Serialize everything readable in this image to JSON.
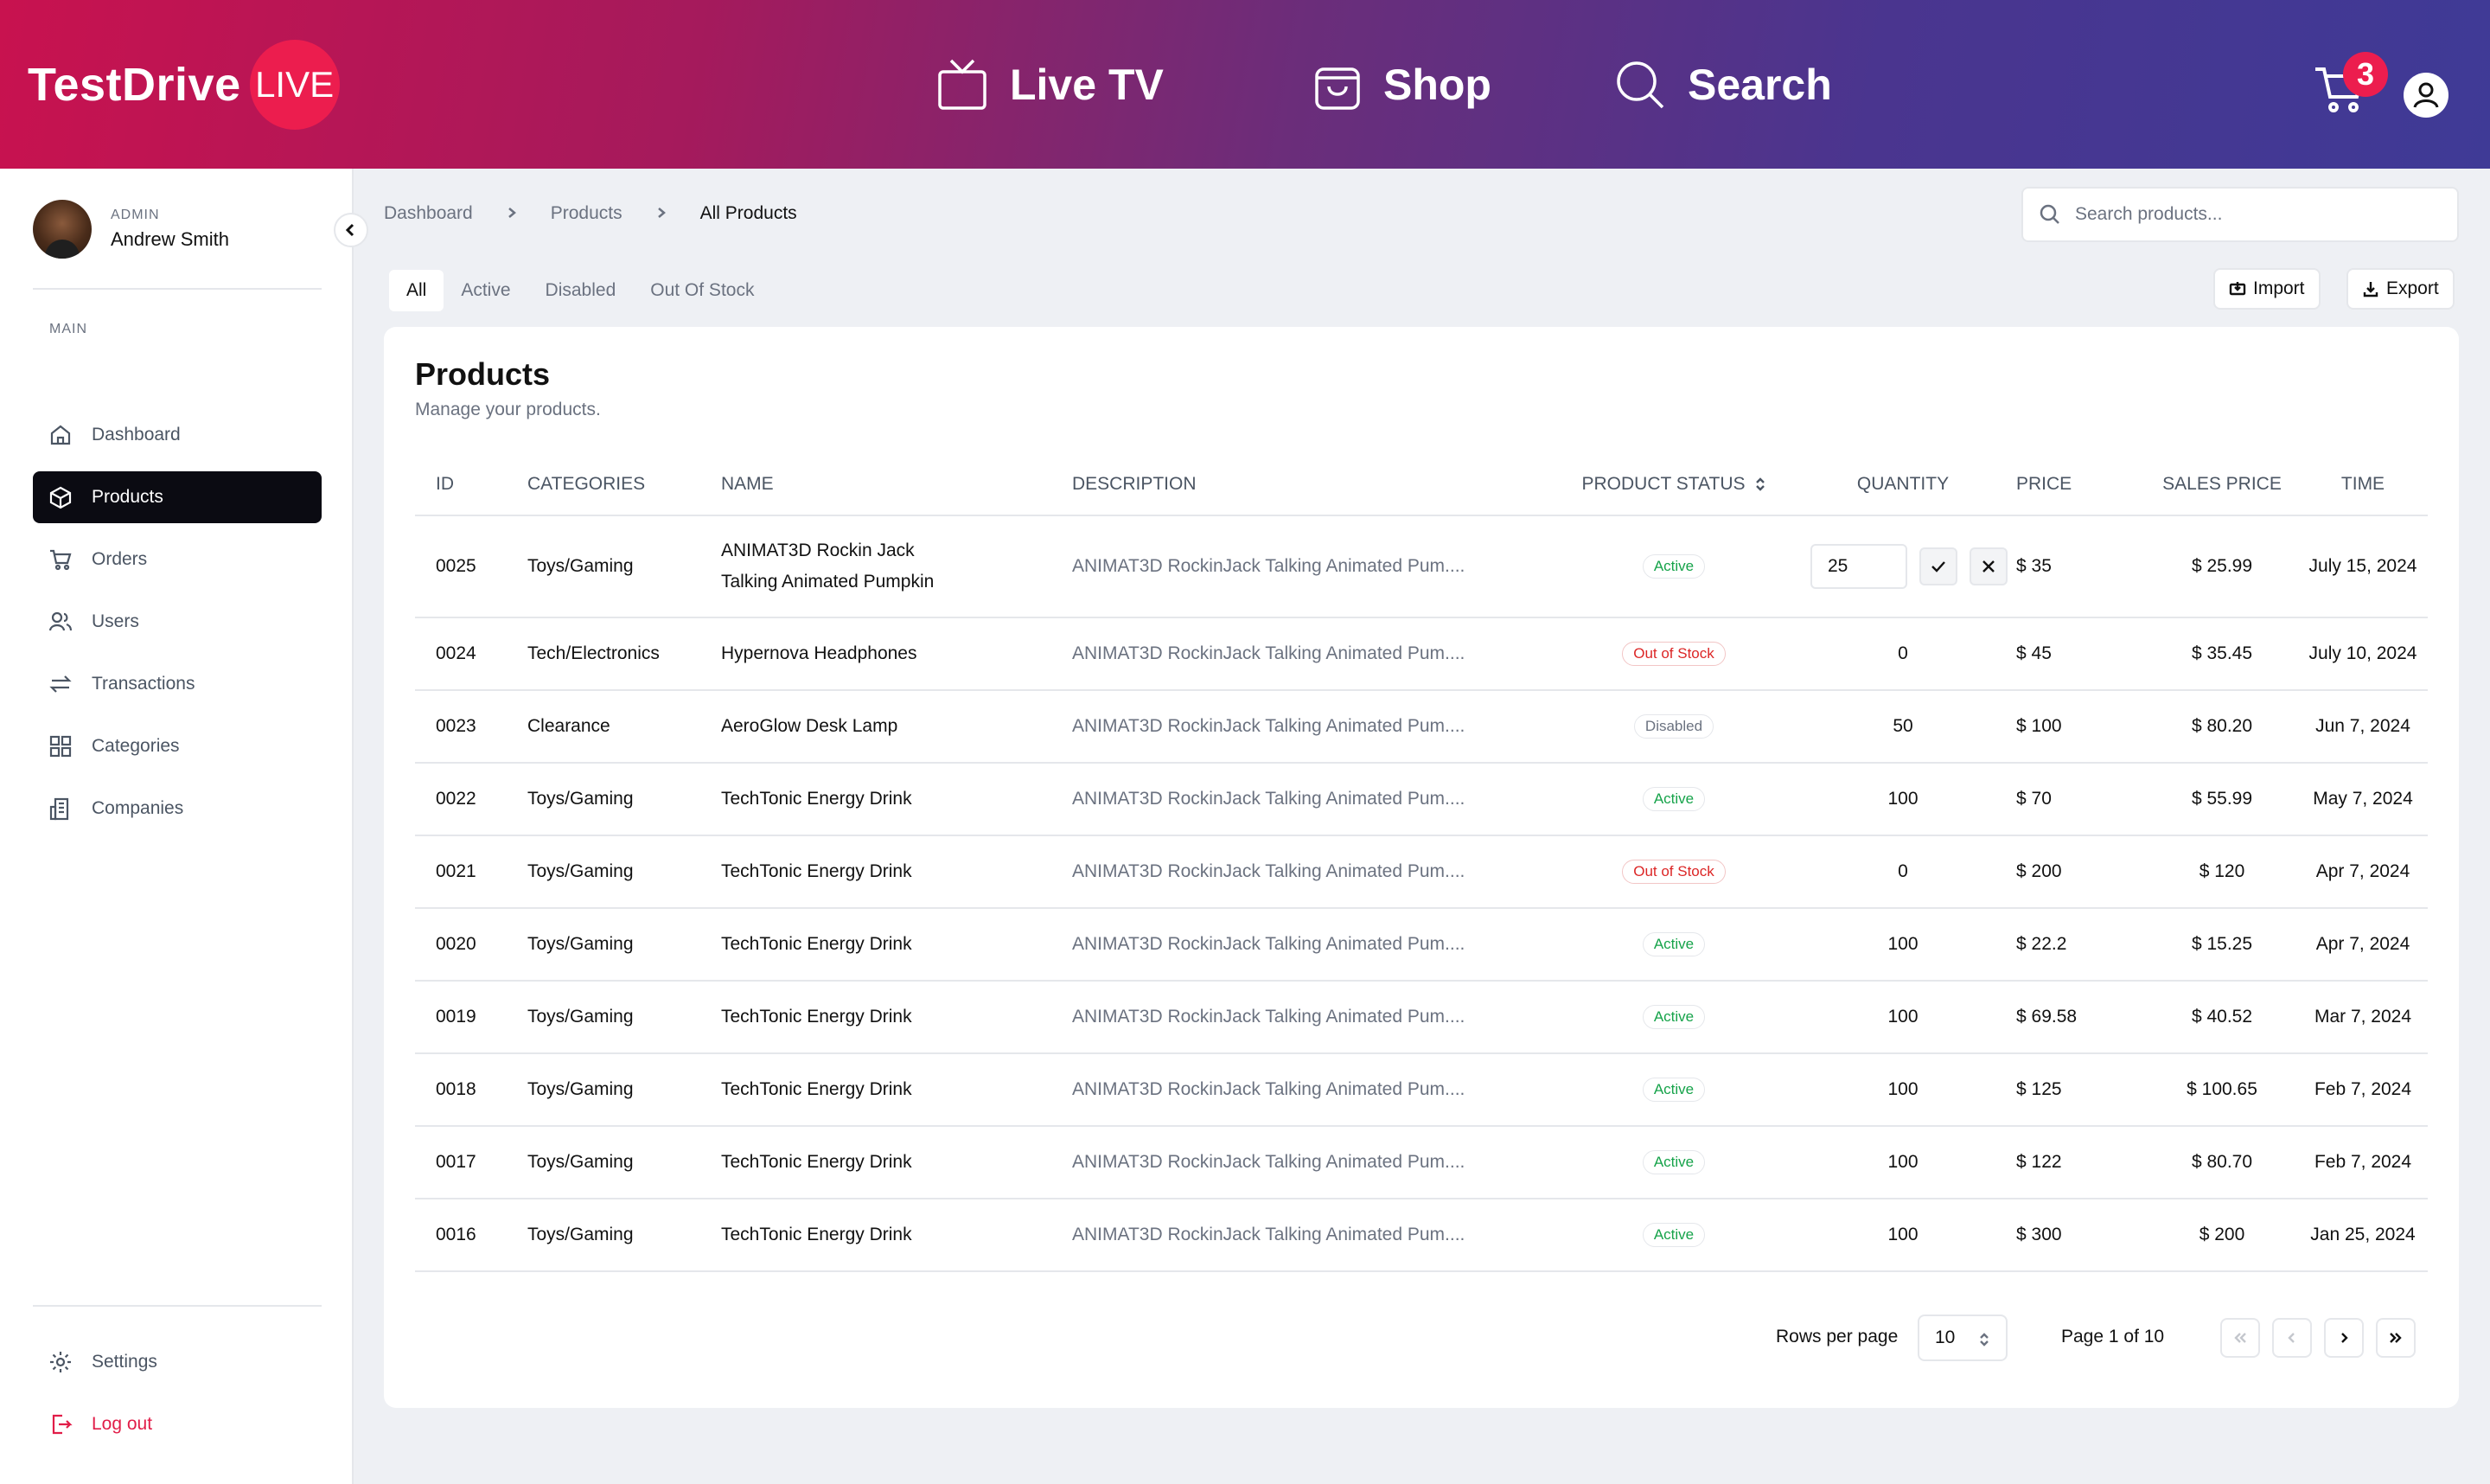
{
  "header": {
    "logo_text": "TestDrive",
    "logo_badge": "LIVE",
    "nav": [
      {
        "label": "Live TV",
        "icon": "tv-icon"
      },
      {
        "label": "Shop",
        "icon": "shopping-bag-icon"
      },
      {
        "label": "Search",
        "icon": "search-icon"
      }
    ],
    "cart_count": "3"
  },
  "sidebar": {
    "role": "ADMIN",
    "user_name": "Andrew Smith",
    "section_label": "MAIN",
    "items": [
      {
        "label": "Dashboard",
        "icon": "home-icon"
      },
      {
        "label": "Products",
        "icon": "box-icon"
      },
      {
        "label": "Orders",
        "icon": "cart-icon"
      },
      {
        "label": "Users",
        "icon": "users-icon"
      },
      {
        "label": "Transactions",
        "icon": "arrows-icon"
      },
      {
        "label": "Categories",
        "icon": "grid-icon"
      },
      {
        "label": "Companies",
        "icon": "building-icon"
      }
    ],
    "active_item": "Products",
    "bottom": {
      "settings": "Settings",
      "logout": "Log out"
    }
  },
  "breadcrumb": [
    "Dashboard",
    "Products",
    "All Products"
  ],
  "search": {
    "placeholder": "Search products..."
  },
  "tabs": [
    "All",
    "Active",
    "Disabled",
    "Out Of Stock"
  ],
  "toolbar": {
    "import": "Import",
    "export": "Export"
  },
  "card": {
    "title": "Products",
    "subtitle": "Manage your products."
  },
  "table": {
    "columns": [
      "ID",
      "CATEGORIES",
      "NAME",
      "DESCRIPTION",
      "PRODUCT STATUS",
      "QUANTITY",
      "PRICE",
      "SALES PRICE",
      "TIME"
    ],
    "rows": [
      {
        "id": "0025",
        "category": "Toys/Gaming",
        "name": "ANIMAT3D Rockin Jack Talking Animated Pumpkin",
        "desc": "ANIMAT3D RockinJack Talking Animated Pum....",
        "status": "Active",
        "qty": "25",
        "price": "$ 35",
        "sales": "$ 25.99",
        "time": "July 15, 2024"
      },
      {
        "id": "0024",
        "category": "Tech/Electronics",
        "name": "Hypernova Headphones",
        "desc": "ANIMAT3D RockinJack Talking Animated Pum....",
        "status": "Out of Stock",
        "qty": "0",
        "price": "$ 45",
        "sales": "$ 35.45",
        "time": "July 10, 2024"
      },
      {
        "id": "0023",
        "category": "Clearance",
        "name": "AeroGlow Desk Lamp",
        "desc": "ANIMAT3D RockinJack Talking Animated Pum....",
        "status": "Disabled",
        "qty": "50",
        "price": "$ 100",
        "sales": "$ 80.20",
        "time": "Jun 7, 2024"
      },
      {
        "id": "0022",
        "category": "Toys/Gaming",
        "name": "TechTonic Energy Drink",
        "desc": "ANIMAT3D RockinJack Talking Animated Pum....",
        "status": "Active",
        "qty": "100",
        "price": "$ 70",
        "sales": "$ 55.99",
        "time": "May 7, 2024"
      },
      {
        "id": "0021",
        "category": "Toys/Gaming",
        "name": "TechTonic Energy Drink",
        "desc": "ANIMAT3D RockinJack Talking Animated Pum....",
        "status": "Out of Stock",
        "qty": "0",
        "price": "$ 200",
        "sales": "$ 120",
        "time": "Apr 7, 2024"
      },
      {
        "id": "0020",
        "category": "Toys/Gaming",
        "name": "TechTonic Energy Drink",
        "desc": "ANIMAT3D RockinJack Talking Animated Pum....",
        "status": "Active",
        "qty": "100",
        "price": "$ 22.2",
        "sales": "$ 15.25",
        "time": "Apr 7, 2024"
      },
      {
        "id": "0019",
        "category": "Toys/Gaming",
        "name": "TechTonic Energy Drink",
        "desc": "ANIMAT3D RockinJack Talking Animated Pum....",
        "status": "Active",
        "qty": "100",
        "price": "$ 69.58",
        "sales": "$ 40.52",
        "time": "Mar 7, 2024"
      },
      {
        "id": "0018",
        "category": "Toys/Gaming",
        "name": "TechTonic Energy Drink",
        "desc": "ANIMAT3D RockinJack Talking Animated Pum....",
        "status": "Active",
        "qty": "100",
        "price": "$ 125",
        "sales": "$ 100.65",
        "time": "Feb 7, 2024"
      },
      {
        "id": "0017",
        "category": "Toys/Gaming",
        "name": "TechTonic Energy Drink",
        "desc": "ANIMAT3D RockinJack Talking Animated Pum....",
        "status": "Active",
        "qty": "100",
        "price": "$ 122",
        "sales": "$ 80.70",
        "time": "Feb 7, 2024"
      },
      {
        "id": "0016",
        "category": "Toys/Gaming",
        "name": "TechTonic Energy Drink",
        "desc": "ANIMAT3D RockinJack Talking Animated Pum....",
        "status": "Active",
        "qty": "100",
        "price": "$ 300",
        "sales": "$ 200",
        "time": "Jan 25, 2024"
      }
    ]
  },
  "pagination": {
    "rows_label": "Rows per page",
    "rows_value": "10",
    "page_label": "Page 1 of 10"
  },
  "colors": {
    "brand_pink": "#ec1d4e",
    "header_start": "#c8124f",
    "header_end": "#3f3a96",
    "active_nav": "#0b0b12",
    "status_active": "#16a34a",
    "status_out": "#dc2626"
  }
}
